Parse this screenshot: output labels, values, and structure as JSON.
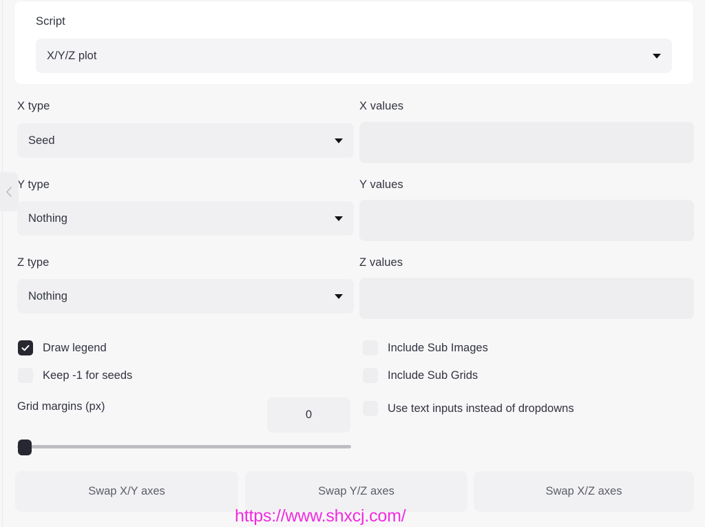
{
  "panel": {
    "collapse_icon": "chevron-left-icon"
  },
  "script_card": {
    "label": "Script",
    "selected": "X/Y/Z plot",
    "caret_icon": "chevron-down-icon"
  },
  "fields": {
    "x": {
      "type_label": "X type",
      "type_value": "Seed",
      "values_label": "X values",
      "values_value": "",
      "values_placeholder": ""
    },
    "y": {
      "type_label": "Y type",
      "type_value": "Nothing",
      "values_label": "Y values",
      "values_value": "",
      "values_placeholder": ""
    },
    "z": {
      "type_label": "Z type",
      "type_value": "Nothing",
      "values_label": "Z values",
      "values_value": "",
      "values_placeholder": ""
    }
  },
  "checkboxes": {
    "draw_legend": {
      "label": "Draw legend",
      "checked": true
    },
    "keep_seeds": {
      "label": "Keep -1 for seeds",
      "checked": false
    },
    "sub_images": {
      "label": "Include Sub Images",
      "checked": false
    },
    "sub_grids": {
      "label": "Include Sub Grids",
      "checked": false
    },
    "text_inputs": {
      "label": "Use text inputs instead of dropdowns",
      "checked": false
    }
  },
  "grid_margins": {
    "label": "Grid margins (px)",
    "value": "0",
    "slider_position_pct": 0
  },
  "buttons": {
    "swap_xy": "Swap X/Y axes",
    "swap_yz": "Swap Y/Z axes",
    "swap_xz": "Swap X/Z axes"
  },
  "watermark": {
    "text": "https://www.shxcj.com/",
    "color": "#f22ae0"
  },
  "colors": {
    "page_bg": "#f7f7f8",
    "card_bg": "#ffffff",
    "input_bg": "#f0f0f2",
    "text": "#31333f",
    "accent_dark": "#262730",
    "button_text": "#5b5d68"
  }
}
